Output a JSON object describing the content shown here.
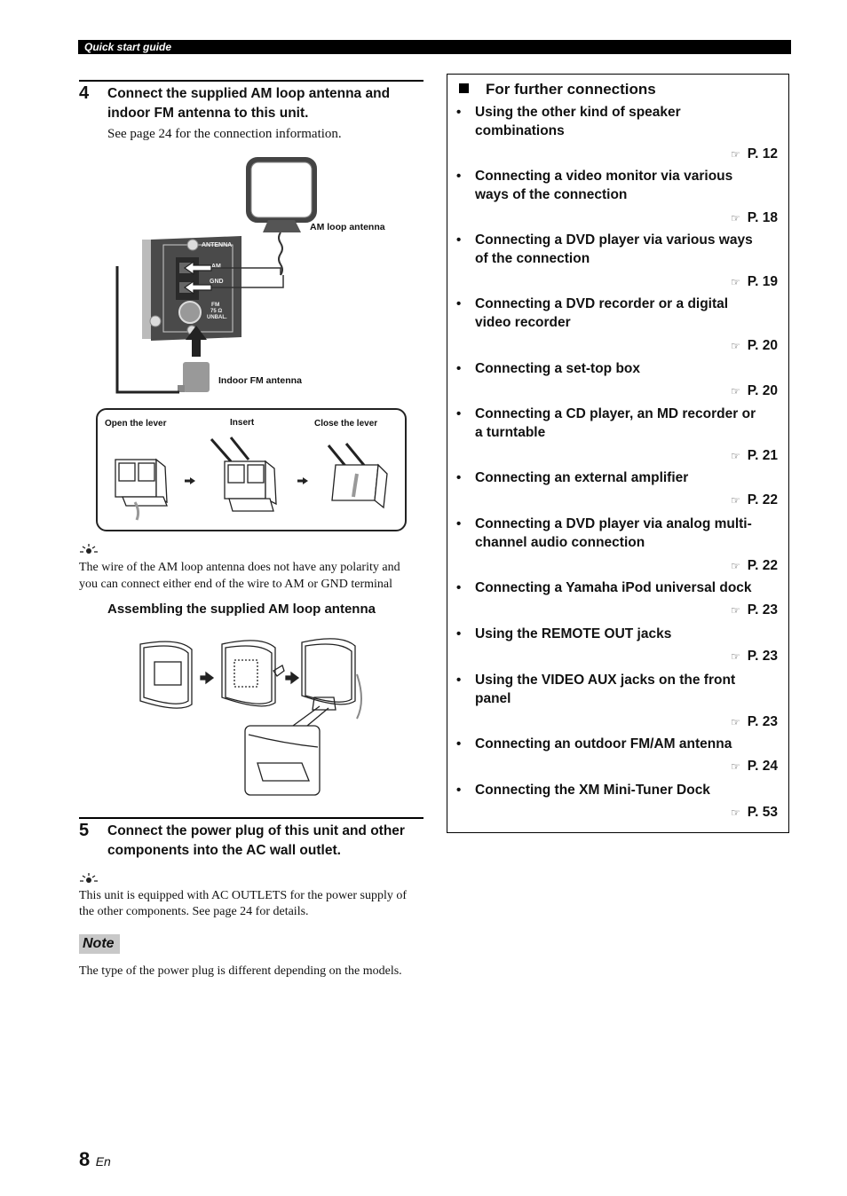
{
  "header": {
    "section": "Quick start guide"
  },
  "step4": {
    "number": "4",
    "title_line1": "Connect the supplied AM loop antenna and",
    "title_line2": "indoor FM antenna to this unit.",
    "body": "See page 24 for the connection information.",
    "figure_labels": {
      "am_loop": "AM loop antenna",
      "indoor_fm": "Indoor FM antenna",
      "panel_antenna": "ANTENNA",
      "panel_am": "AM",
      "panel_gnd": "GND",
      "panel_fm1": "FM",
      "panel_fm2": "75 Ω",
      "panel_fm3": "UNBAL."
    },
    "lever_steps": [
      "Open the lever",
      "Insert",
      "Close the lever"
    ],
    "tip_text_line1": "The wire of the AM loop antenna does not have any polarity and",
    "tip_text_line2": "you can connect either end of the wire to AM or GND terminal",
    "assembling_heading": "Assembling the supplied AM loop antenna"
  },
  "step5": {
    "number": "5",
    "title_line1": "Connect the power plug of this unit and other",
    "title_line2": "components into the AC wall outlet.",
    "tip_line1": "This unit is equipped with AC OUTLETS for the power supply of",
    "tip_line2": "the other components. See page 24 for details.",
    "note_label": "Note",
    "note_text": "The type of the power plug is different depending on the models."
  },
  "further": {
    "title": "For further connections",
    "ref_icon": "☞",
    "items": [
      {
        "line1": "Using the other kind of speaker",
        "line2": "combinations",
        "ref": "P. 12"
      },
      {
        "line1": "Connecting a video monitor via various",
        "line2": "ways of the connection",
        "ref": "P. 18"
      },
      {
        "line1": "Connecting a DVD player via various ways",
        "line2": "of the connection",
        "ref": "P. 19"
      },
      {
        "line1": "Connecting a DVD recorder or a digital",
        "line2": "video recorder",
        "ref": "P. 20"
      },
      {
        "line1": "Connecting a set-top box",
        "line2": "",
        "ref": "P. 20"
      },
      {
        "line1": "Connecting a CD player, an MD recorder or",
        "line2": "a turntable",
        "ref": "P. 21"
      },
      {
        "line1": "Connecting an external amplifier",
        "line2": "",
        "ref": "P. 22"
      },
      {
        "line1": "Connecting a DVD player via analog multi-",
        "line2": "channel audio connection",
        "ref": "P. 22"
      },
      {
        "line1": "Connecting a Yamaha iPod universal dock",
        "line2": "",
        "ref": "P. 23"
      },
      {
        "line1": "Using the REMOTE OUT jacks",
        "line2": "",
        "ref": "P. 23"
      },
      {
        "line1": "Using the VIDEO AUX jacks on the front",
        "line2": "panel",
        "ref": "P. 23"
      },
      {
        "line1": "Connecting an outdoor FM/AM antenna",
        "line2": "",
        "ref": "P. 24"
      },
      {
        "line1": "Connecting the XM Mini-Tuner Dock",
        "line2": "",
        "ref": "P. 53"
      }
    ]
  },
  "footer": {
    "page_number": "8",
    "language": "En"
  }
}
